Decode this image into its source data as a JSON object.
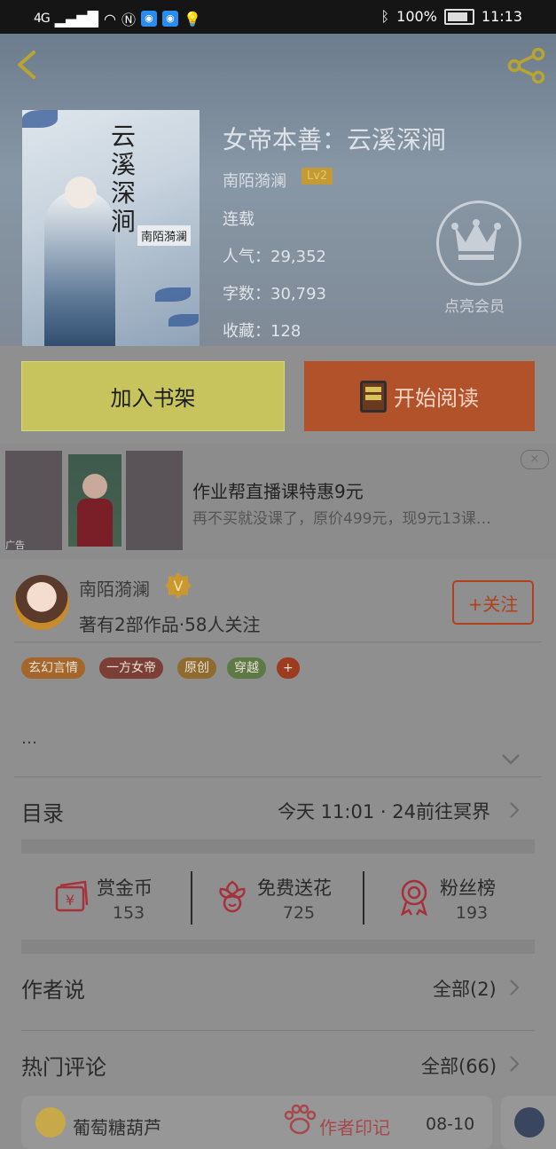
{
  "status": {
    "left_icons": "4G",
    "battery": "100%",
    "time": "11:13"
  },
  "book": {
    "title": "女帝本善：云溪深涧",
    "cover_title": "云溪深涧",
    "cover_author": "南陌漪澜",
    "author": "南陌漪澜",
    "level": "Lv2",
    "status": "连载",
    "popularity": "人气：29,352",
    "words": "字数：30,793",
    "favorites": "收藏：128"
  },
  "vip": {
    "label": "点亮会员"
  },
  "actions": {
    "add_shelf": "加入书架",
    "start_read": "开始阅读"
  },
  "ad": {
    "title": "作业帮直播课特惠9元",
    "subtitle": "再不买就没课了，原价499元，现9元13课…",
    "tag": "广告",
    "close": "×"
  },
  "author": {
    "name": "南陌漪澜",
    "meta": "著有2部作品·58人关注",
    "follow": "+关注"
  },
  "tags": [
    {
      "label": "玄幻言情",
      "color": "#a4662a"
    },
    {
      "label": "一方女帝",
      "color": "#7b3f35"
    },
    {
      "label": "原创",
      "color": "#8f6b30"
    },
    {
      "label": "穿越",
      "color": "#5d7a46"
    },
    {
      "label": "+",
      "color": "#9c3b1e"
    }
  ],
  "intro": {
    "text": "…"
  },
  "catalog": {
    "label": "目录",
    "latest": "今天 11:01 · 24前往冥界"
  },
  "gifts": [
    {
      "label": "赏金币",
      "count": "153"
    },
    {
      "label": "免费送花",
      "count": "725"
    },
    {
      "label": "粉丝榜",
      "count": "193"
    }
  ],
  "author_says": {
    "label": "作者说",
    "all": "全部(2)"
  },
  "hot_comments": {
    "label": "热门评论",
    "all": "全部(66)"
  },
  "comment": {
    "user": "葡萄糖葫芦",
    "mark": "作者印记",
    "date": "08-10"
  }
}
